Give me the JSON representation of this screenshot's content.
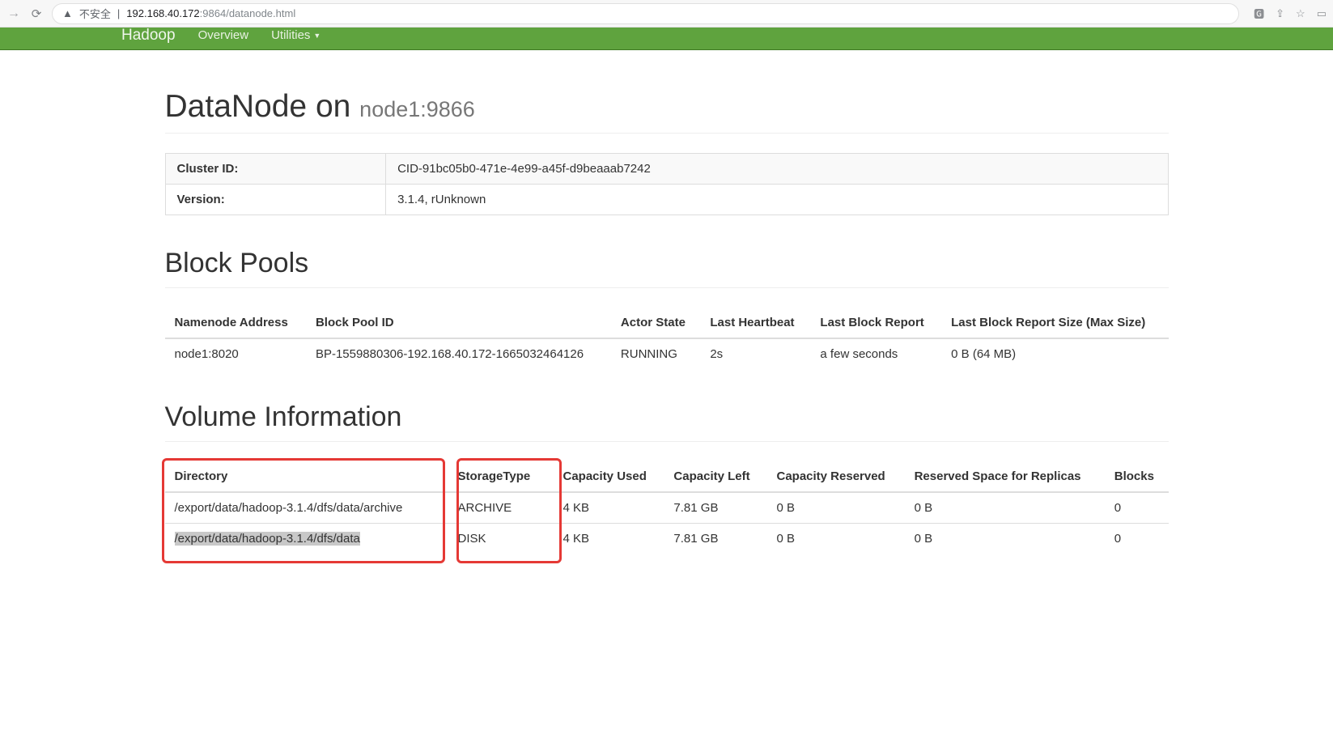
{
  "chrome": {
    "insecure_label": "不安全",
    "url_host": "192.168.40.172",
    "url_port": ":9864",
    "url_path": "/datanode.html"
  },
  "navbar": {
    "brand": "Hadoop",
    "links": {
      "overview": "Overview",
      "utilities": "Utilities"
    }
  },
  "header": {
    "title": "DataNode on ",
    "subtitle": "node1:9866"
  },
  "info": {
    "cluster_id_label": "Cluster ID:",
    "cluster_id_value": "CID-91bc05b0-471e-4e99-a45f-d9beaaab7242",
    "version_label": "Version:",
    "version_value": "3.1.4, rUnknown"
  },
  "blockpools": {
    "heading": "Block Pools",
    "columns": {
      "namenode": "Namenode Address",
      "bpid": "Block Pool ID",
      "actor": "Actor State",
      "heartbeat": "Last Heartbeat",
      "blockreport": "Last Block Report",
      "blockreportsize": "Last Block Report Size (Max Size)"
    },
    "rows": [
      {
        "namenode": "node1:8020",
        "bpid": "BP-1559880306-192.168.40.172-1665032464126",
        "actor": "RUNNING",
        "heartbeat": "2s",
        "blockreport": "a few seconds",
        "blockreportsize": "0 B (64 MB)"
      }
    ]
  },
  "volumes": {
    "heading": "Volume Information",
    "columns": {
      "directory": "Directory",
      "storagetype": "StorageType",
      "capused": "Capacity Used",
      "capleft": "Capacity Left",
      "capres": "Capacity Reserved",
      "resrepl": "Reserved Space for Replicas",
      "blocks": "Blocks"
    },
    "rows": [
      {
        "directory": "/export/data/hadoop-3.1.4/dfs/data/archive",
        "storagetype": "ARCHIVE",
        "capused": "4 KB",
        "capleft": "7.81 GB",
        "capres": "0 B",
        "resrepl": "0 B",
        "blocks": "0"
      },
      {
        "directory": "/export/data/hadoop-3.1.4/dfs/data",
        "storagetype": "DISK",
        "capused": "4 KB",
        "capleft": "7.81 GB",
        "capres": "0 B",
        "resrepl": "0 B",
        "blocks": "0"
      }
    ]
  }
}
